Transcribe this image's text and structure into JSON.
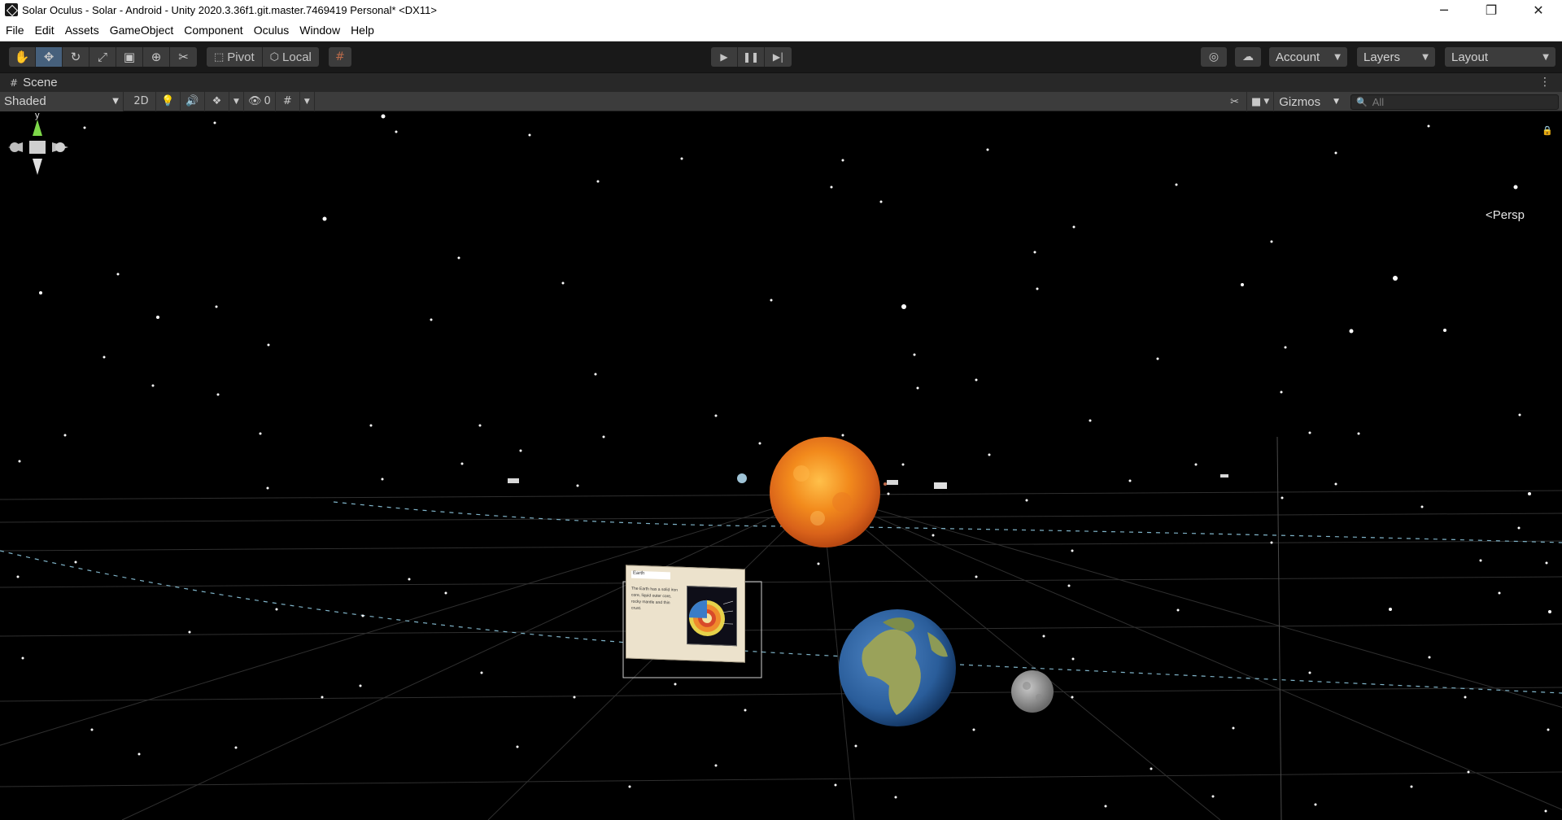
{
  "window": {
    "title": "Solar Oculus - Solar - Android - Unity 2020.3.36f1.git.master.7469419 Personal* <DX11>",
    "controls": {
      "minimize": "─",
      "maximize": "❐",
      "close": "✕"
    }
  },
  "menu": {
    "items": [
      "File",
      "Edit",
      "Assets",
      "GameObject",
      "Component",
      "Oculus",
      "Window",
      "Help"
    ]
  },
  "toolbar": {
    "tools": [
      {
        "name": "hand-tool",
        "icon": "✋"
      },
      {
        "name": "move-tool",
        "icon": "✥"
      },
      {
        "name": "rotate-tool",
        "icon": "↻"
      },
      {
        "name": "scale-tool",
        "icon": "⤢"
      },
      {
        "name": "rect-tool",
        "icon": "▣"
      },
      {
        "name": "transform-tool",
        "icon": "⊕"
      },
      {
        "name": "custom-tool",
        "icon": "✂"
      }
    ],
    "active_tool": "move-tool",
    "pivot_label": "Pivot",
    "local_label": "Local",
    "grid_snap_icon": "#",
    "play_icon": "▶",
    "pause_icon": "❚❚",
    "step_icon": "▶|",
    "collab_icon": "◎",
    "cloud_icon": "☁",
    "account_label": "Account",
    "layers_label": "Layers",
    "layout_label": "Layout",
    "caret": "▼"
  },
  "scene_tab": {
    "label": "Scene",
    "icon": "#",
    "menu_icon": "⋮"
  },
  "scene_toolbar": {
    "shading_mode": "Shaded",
    "mode_2d": "2D",
    "lighting_icon": "💡",
    "audio_icon": "🔊",
    "effects_icon": "❖",
    "hidden_icon": "👁",
    "hidden_count": "0",
    "grid_icon": "#",
    "tools_icon": "✂",
    "camera_icon": "■",
    "gizmos_label": "Gizmos",
    "search_placeholder": "All",
    "search_icon": "🔍"
  },
  "scene": {
    "persp_label": "<Persp",
    "axis_y": "y",
    "lock_icon": "🔒",
    "info_panel": {
      "title": "Earth",
      "text": "The Earth has a solid iron core, liquid outer core, rocky mantle and thin crust."
    }
  }
}
